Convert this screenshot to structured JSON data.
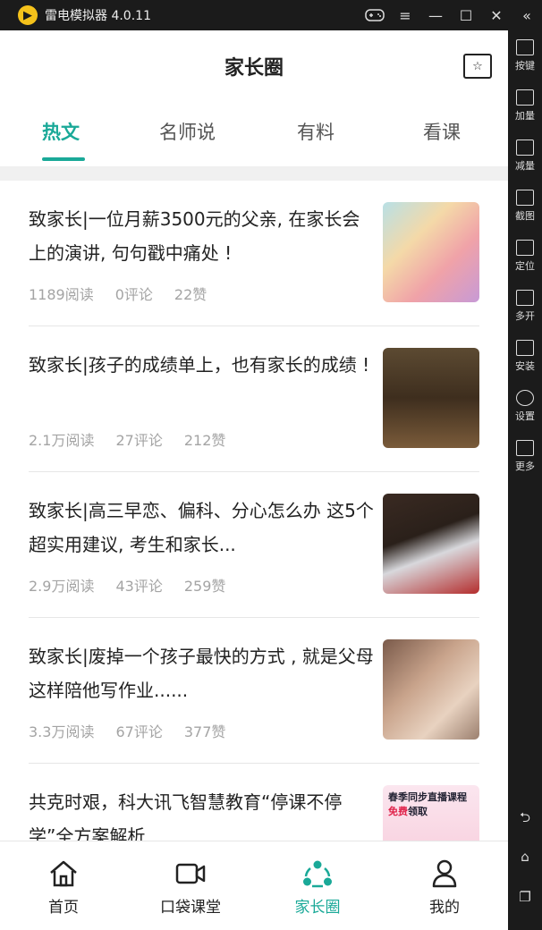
{
  "window": {
    "app_title": "雷电模拟器 4.0.11"
  },
  "appbar": {
    "title": "家长圈"
  },
  "tabs": [
    {
      "label": "热文",
      "active": true
    },
    {
      "label": "名师说",
      "active": false
    },
    {
      "label": "有料",
      "active": false
    },
    {
      "label": "看课",
      "active": false
    }
  ],
  "articles": [
    {
      "title": "致家长|一位月薪3500元的父亲, 在家长会上的演讲, 句句戳中痛处 !",
      "reads": "1189阅读",
      "comments": "0评论",
      "likes": "22赞"
    },
    {
      "title": "致家长|孩子的成绩单上，也有家长的成绩 !",
      "reads": "2.1万阅读",
      "comments": "27评论",
      "likes": "212赞"
    },
    {
      "title": "致家长|高三早恋、偏科、分心怎么办 这5个超实用建议, 考生和家长...",
      "reads": "2.9万阅读",
      "comments": "43评论",
      "likes": "259赞"
    },
    {
      "title": "致家长|废掉一个孩子最快的方式 , 就是父母这样陪他写作业......",
      "reads": "3.3万阅读",
      "comments": "67评论",
      "likes": "377赞"
    },
    {
      "title": "共克时艰，科大讯飞智慧教育“停课不停学”全方案解析",
      "thumb_line1": "春季同步直播课程",
      "thumb_free": "免费",
      "thumb_line2": "领取"
    }
  ],
  "bottom_nav": [
    {
      "label": "首页",
      "icon": "home-icon",
      "active": false
    },
    {
      "label": "口袋课堂",
      "icon": "video-icon",
      "active": false
    },
    {
      "label": "家长圈",
      "icon": "community-icon",
      "active": true
    },
    {
      "label": "我的",
      "icon": "user-icon",
      "active": false
    }
  ],
  "toolbar": [
    {
      "label": "按键",
      "icon": "keyboard-icon"
    },
    {
      "label": "加量",
      "icon": "volume-up-icon"
    },
    {
      "label": "减量",
      "icon": "volume-down-icon"
    },
    {
      "label": "截图",
      "icon": "screenshot-icon"
    },
    {
      "label": "定位",
      "icon": "location-icon"
    },
    {
      "label": "多开",
      "icon": "multi-instance-icon"
    },
    {
      "label": "安装",
      "icon": "install-icon"
    },
    {
      "label": "设置",
      "icon": "gear-icon"
    },
    {
      "label": "更多",
      "icon": "more-icon"
    }
  ],
  "colors": {
    "accent": "#1aa998",
    "emulator_bg": "#1b1b1b"
  }
}
